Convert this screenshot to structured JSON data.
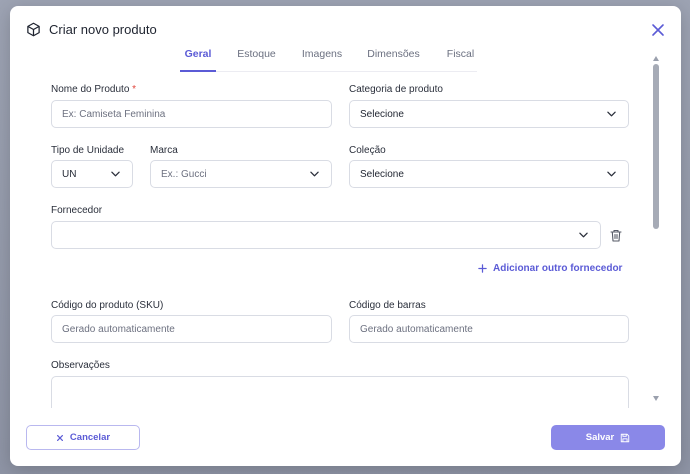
{
  "modal": {
    "title": "Criar novo produto",
    "icons": {
      "title": "cube-icon",
      "close": "close-icon"
    }
  },
  "tabs": [
    {
      "label": "Geral",
      "active": true
    },
    {
      "label": "Estoque",
      "active": false
    },
    {
      "label": "Imagens",
      "active": false
    },
    {
      "label": "Dimensões",
      "active": false
    },
    {
      "label": "Fiscal",
      "active": false
    }
  ],
  "form": {
    "product_name": {
      "label": "Nome do Produto",
      "required_mark": "*",
      "placeholder": "Ex: Camiseta Feminina"
    },
    "category": {
      "label": "Categoria de produto",
      "value": "Selecione"
    },
    "unit_type": {
      "label": "Tipo de Unidade",
      "value": "UN"
    },
    "brand": {
      "label": "Marca",
      "placeholder": "Ex.: Gucci"
    },
    "collection": {
      "label": "Coleção",
      "value": "Selecione"
    },
    "supplier": {
      "label": "Fornecedor",
      "value": ""
    },
    "add_supplier": {
      "label": "Adicionar outro fornecedor"
    },
    "sku": {
      "label": "Código do produto (SKU)",
      "placeholder": "Gerado automaticamente"
    },
    "barcode": {
      "label": "Código de barras",
      "placeholder": "Gerado automaticamente"
    },
    "notes": {
      "label": "Observações",
      "value": ""
    }
  },
  "footer": {
    "cancel_label": "Cancelar",
    "save_label": "Salvar"
  },
  "colors": {
    "accent": "#5b5bd6",
    "save_button": "#8a88e8",
    "required": "#e0443a"
  }
}
